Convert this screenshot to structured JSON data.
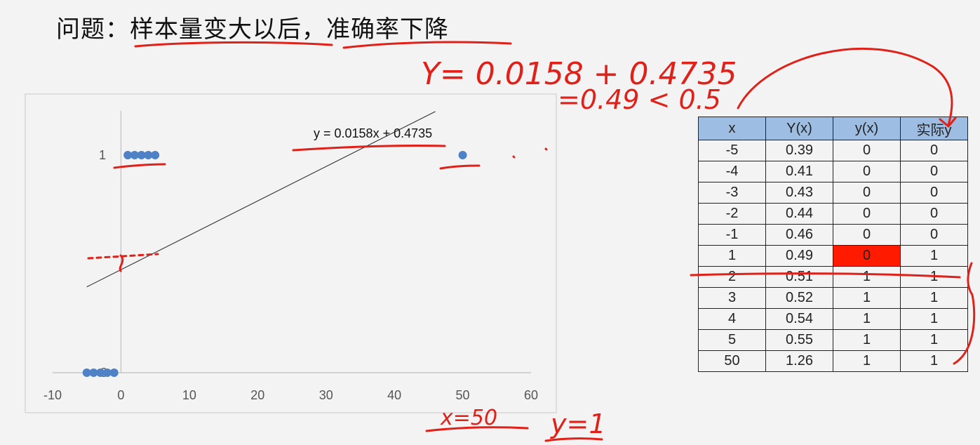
{
  "title": "问题：样本量变大以后，准确率下降",
  "chart_data": {
    "type": "scatter",
    "x": [
      -5,
      -4,
      -3,
      -2,
      -1,
      1,
      2,
      3,
      4,
      5,
      50
    ],
    "y": [
      0,
      0,
      0,
      0,
      0,
      1,
      1,
      1,
      1,
      1,
      1
    ],
    "trendline": {
      "slope": 0.0158,
      "intercept": 0.4735,
      "label": "y = 0.0158x + 0.4735",
      "x_range": [
        -5,
        46
      ]
    },
    "xlim": [
      -10,
      60
    ],
    "ylim": [
      0,
      1
    ],
    "xticks": [
      "-10",
      "0",
      "10",
      "20",
      "30",
      "40",
      "50",
      "60"
    ],
    "yticks": [
      "0",
      "1"
    ],
    "point_color": "#4f81c7",
    "line_color": "#333333"
  },
  "table": {
    "headers": [
      "x",
      "Y(x)",
      "y(x)",
      "实际y"
    ],
    "rows": [
      [
        "-5",
        "0.39",
        "0",
        "0"
      ],
      [
        "-4",
        "0.41",
        "0",
        "0"
      ],
      [
        "-3",
        "0.43",
        "0",
        "0"
      ],
      [
        "-2",
        "0.44",
        "0",
        "0"
      ],
      [
        "-1",
        "0.46",
        "0",
        "0"
      ],
      [
        "1",
        "0.49",
        "0",
        "1"
      ],
      [
        "2",
        "0.51",
        "1",
        "1"
      ],
      [
        "3",
        "0.52",
        "1",
        "1"
      ],
      [
        "4",
        "0.54",
        "1",
        "1"
      ],
      [
        "5",
        "0.55",
        "1",
        "1"
      ],
      [
        "50",
        "1.26",
        "1",
        "1"
      ]
    ],
    "highlight": {
      "row": 5,
      "col": 2,
      "color": "#ff1a00"
    },
    "header_color": "#9dbde3"
  },
  "annotations": {
    "equation": "Y= 0.0158 + 0.4735",
    "result": "=0.49 < 0.5",
    "x_note": "x=50",
    "y_note": "y=1",
    "ink_color": "#e0211a"
  }
}
